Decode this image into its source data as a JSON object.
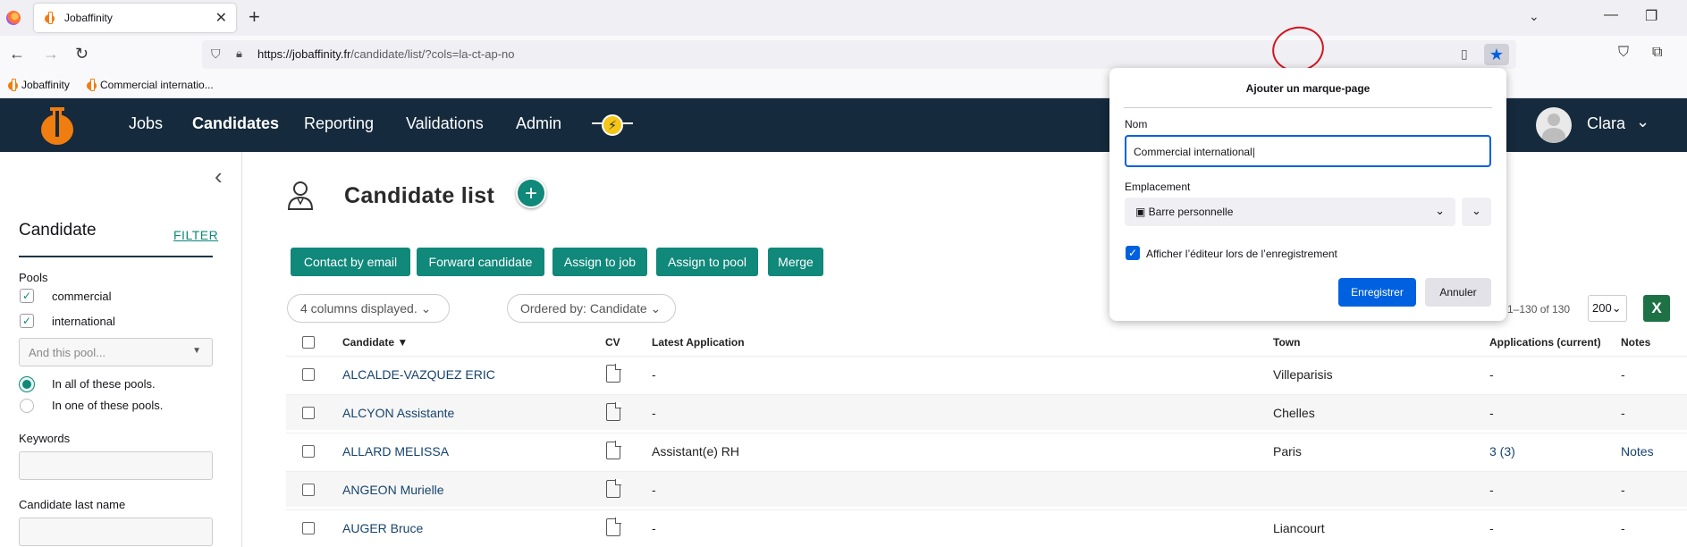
{
  "browser": {
    "tab_title": "Jobaffinity",
    "url_host": "https://jobaffinity.fr",
    "url_path": "/candidate/list/?cols=la-ct-ap-no",
    "bookmarks": [
      "Jobaffinity",
      "Commercial internatio..."
    ]
  },
  "nav": {
    "menu": [
      "Jobs",
      "Candidates",
      "Reporting",
      "Validations",
      "Admin"
    ],
    "user": "Clara"
  },
  "sidebar": {
    "title": "Candidate",
    "filter_link": "FILTER",
    "pools_label": "Pools",
    "pools": [
      "commercial",
      "international"
    ],
    "pool_select_placeholder": "And this pool...",
    "radio_options": [
      "In all of these pools.",
      "In one of these pools."
    ],
    "keywords_label": "Keywords",
    "lastname_label": "Candidate last name"
  },
  "main": {
    "title": "Candidate list",
    "actions": [
      "Contact by email",
      "Forward candidate",
      "Assign to job",
      "Assign to pool",
      "Merge"
    ],
    "columns_pill": "4  columns displayed.",
    "ordered_pill": "Ordered by: Candidate",
    "pager": "1–130 of 130",
    "per_page": "200",
    "excel_label": "X",
    "headers": {
      "candidate": "Candidate",
      "cv": "CV",
      "latest": "Latest Application",
      "town": "Town",
      "applications": "Applications (current)",
      "notes": "Notes"
    },
    "rows": [
      {
        "name": "ALCALDE-VAZQUEZ ERIC",
        "latest": "-",
        "town": "Villeparisis",
        "apps": "-",
        "notes": "-"
      },
      {
        "name": "ALCYON Assistante",
        "latest": "-",
        "town": "Chelles",
        "apps": "-",
        "notes": "-"
      },
      {
        "name": "ALLARD MELISSA",
        "latest": "Assistant(e) RH",
        "town": "Paris",
        "apps": "3 (3)",
        "notes": "Notes"
      },
      {
        "name": "ANGEON Murielle",
        "latest": "-",
        "town": "",
        "apps": "-",
        "notes": "-"
      },
      {
        "name": "AUGER Bruce",
        "latest": "-",
        "town": "Liancourt",
        "apps": "-",
        "notes": "-"
      }
    ]
  },
  "popup": {
    "title": "Ajouter un marque-page",
    "name_label": "Nom",
    "name_value": "Commercial international",
    "location_label": "Emplacement",
    "location_value": "Barre personnelle",
    "show_editor_label": "Afficher l’éditeur lors de l’enregistrement",
    "save": "Enregistrer",
    "cancel": "Annuler"
  },
  "colors": {
    "header_bg": "#152a3d",
    "accent_green": "#10887a",
    "firefox_blue": "#0061e0",
    "logo_orange": "#f07d10",
    "annotation_red": "#d2141e"
  }
}
